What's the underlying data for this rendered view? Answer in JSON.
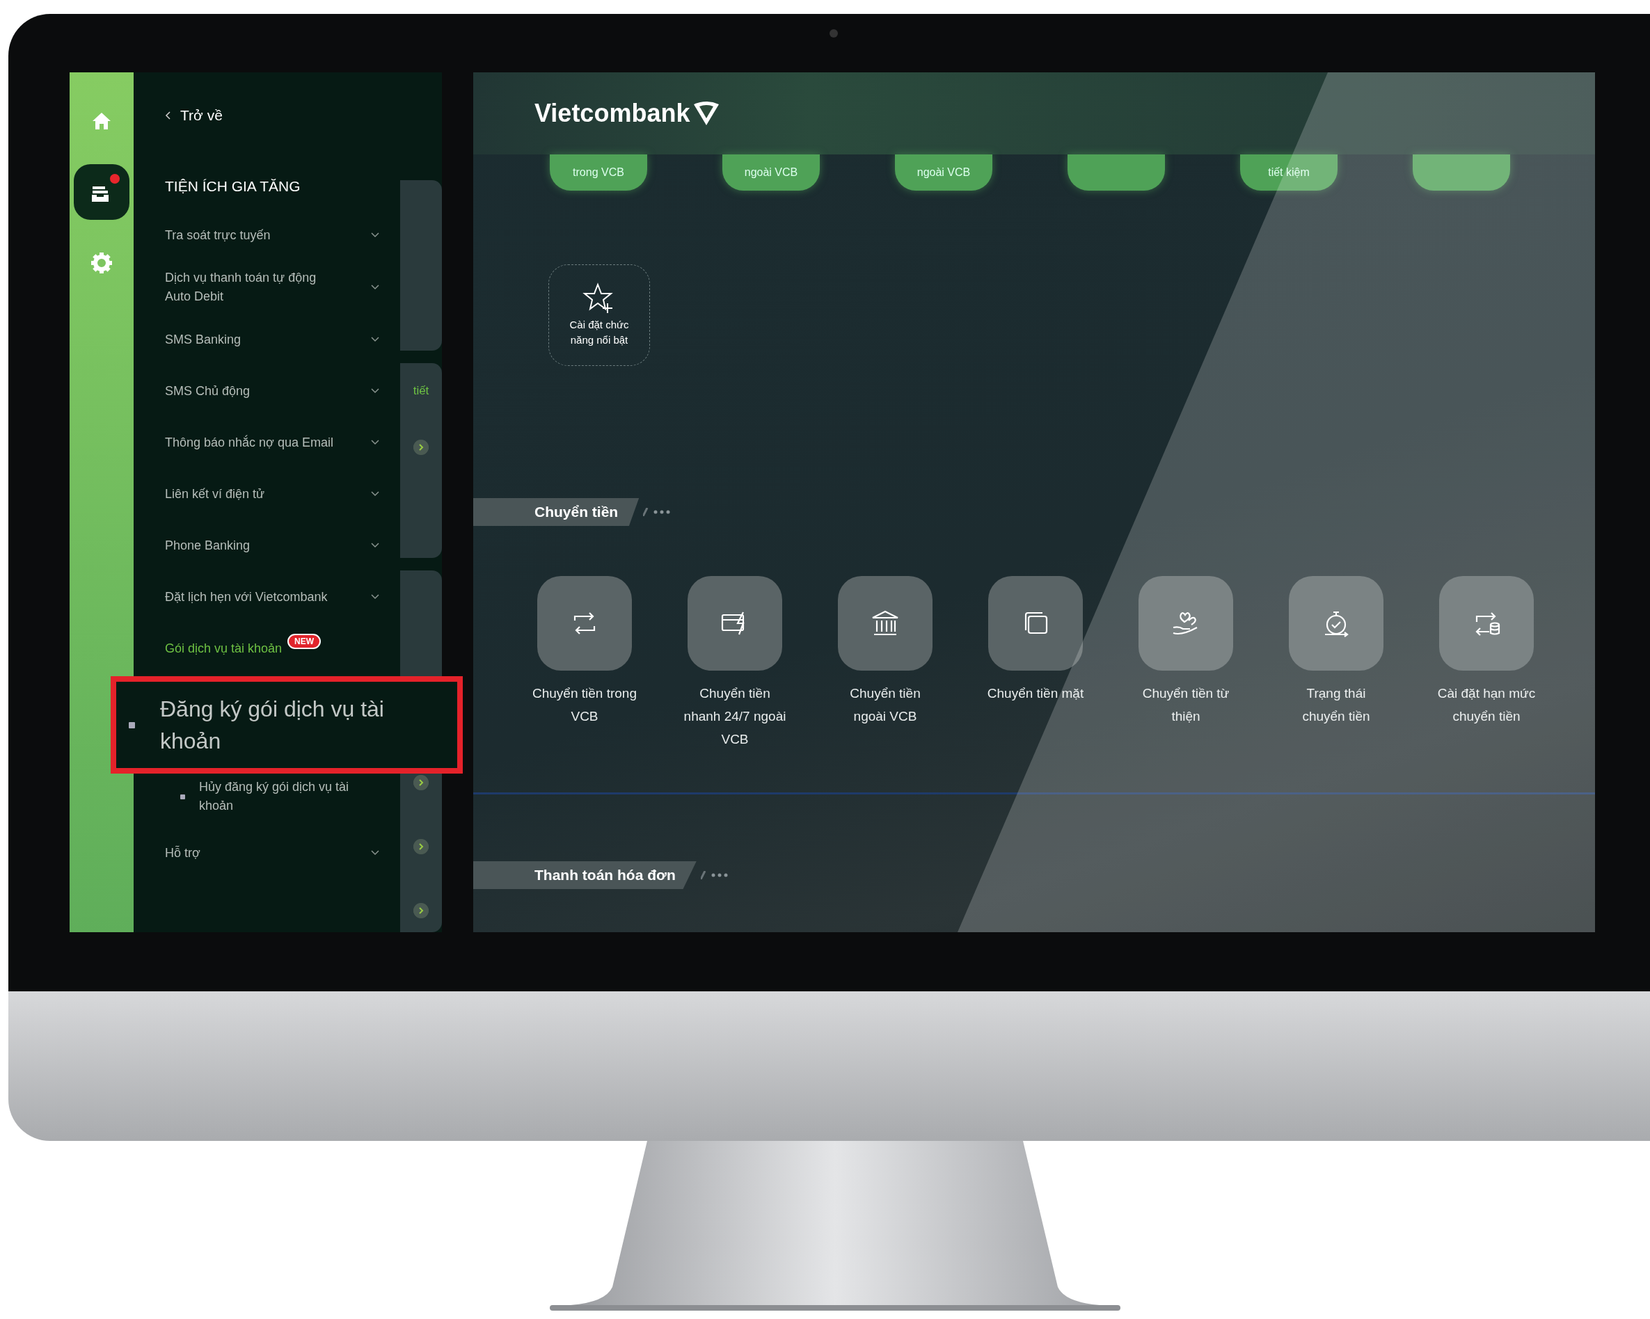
{
  "rail": [
    {
      "selected": false
    },
    {
      "selected": true,
      "notification": true
    },
    {
      "selected": false
    }
  ],
  "sidebar": {
    "back": "Trở về",
    "title": "TIỆN ÍCH GIA TĂNG",
    "items": [
      {
        "label": "Tra soát trực tuyến",
        "expanded": false
      },
      {
        "label": "Dịch vụ thanh toán tự động Auto Debit",
        "expanded": false
      },
      {
        "label": "SMS Banking",
        "expanded": false
      },
      {
        "label": "SMS Chủ động",
        "expanded": false
      },
      {
        "label": "Thông báo nhắc nợ qua Email",
        "expanded": false
      },
      {
        "label": "Liên kết ví điện tử",
        "expanded": false
      },
      {
        "label": "Phone Banking",
        "expanded": false
      },
      {
        "label": "Đặt lịch hẹn với Vietcombank",
        "expanded": false
      },
      {
        "label": "Gói dịch vụ tài khoản",
        "expanded": true,
        "badge": "NEW",
        "children": [
          {
            "label": "Đăng ký gói dịch vụ tài khoản",
            "highlighted": true
          },
          {
            "label": "Hủy đăng ký gói dịch vụ tài khoản",
            "highlighted": false
          }
        ]
      },
      {
        "label": "Hỗ trợ",
        "expanded": false
      }
    ]
  },
  "background_panel": {
    "link_text": "tiết"
  },
  "header": {
    "logo": "Vietcombank"
  },
  "quick_actions": [
    {
      "label": "trong VCB"
    },
    {
      "label": "ngoài VCB"
    },
    {
      "label": "ngoài VCB"
    },
    {
      "label": "tiết kiệm"
    }
  ],
  "featured": {
    "label": "Cài đặt chức năng nổi bật"
  },
  "sections": [
    {
      "title": "Chuyển tiền",
      "items": [
        {
          "label": "Chuyển tiền trong VCB"
        },
        {
          "label": "Chuyển tiền nhanh 24/7 ngoài VCB"
        },
        {
          "label": "Chuyển tiền ngoài VCB"
        },
        {
          "label": "Chuyển tiền mặt"
        },
        {
          "label": "Chuyển tiền từ thiện"
        },
        {
          "label": "Trạng thái chuyển tiền"
        },
        {
          "label": "Cài đặt hạn mức chuyển tiền"
        }
      ]
    },
    {
      "title": "Thanh toán hóa đơn"
    }
  ]
}
